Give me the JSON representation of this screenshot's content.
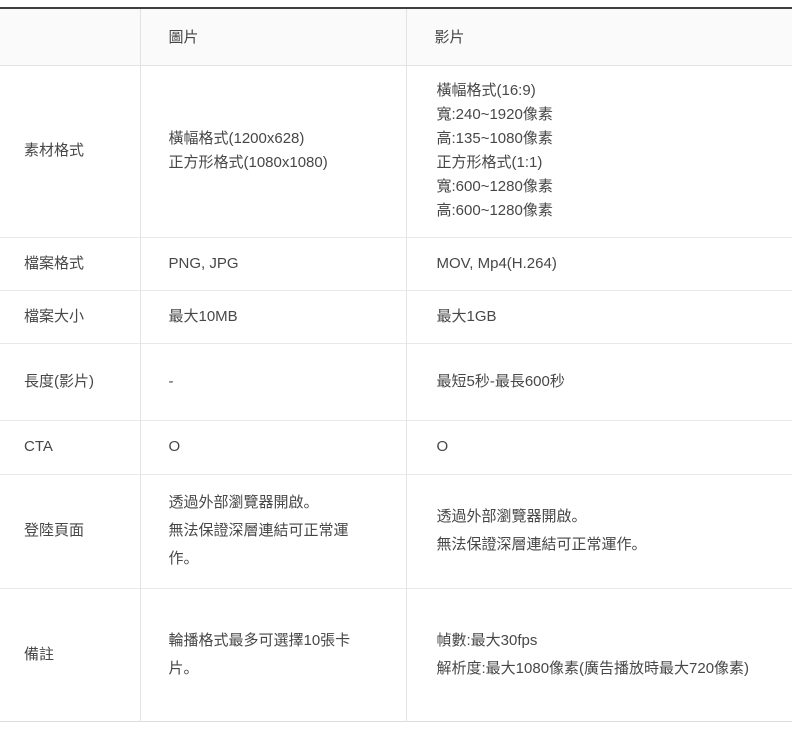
{
  "table": {
    "columns": [
      {
        "label": ""
      },
      {
        "label": "圖片"
      },
      {
        "label": "影片"
      }
    ],
    "rows": [
      {
        "label": "素材格式",
        "image": [
          "橫幅格式(1200x628)",
          "正方形格式(1080x1080)"
        ],
        "video": [
          "橫幅格式(16:9)",
          "寬:240~1920像素",
          "高:135~1080像素",
          "正方形格式(1:1)",
          "寬:600~1280像素",
          "高:600~1280像素"
        ],
        "variant": "tight"
      },
      {
        "label": "檔案格式",
        "image": [
          "PNG, JPG"
        ],
        "video": [
          "MOV, Mp4(H.264)"
        ],
        "variant": "tight"
      },
      {
        "label": "檔案大小",
        "image": [
          "最大10MB"
        ],
        "video": [
          "最大1GB"
        ],
        "variant": "tight"
      },
      {
        "label": "長度(影片)",
        "image": [
          "-"
        ],
        "video": [
          "最短5秒-最長600秒"
        ],
        "variant": "tight"
      },
      {
        "label": "CTA",
        "image": [
          "O"
        ],
        "video": [
          "O"
        ],
        "variant": "tight"
      },
      {
        "label": "登陸頁面",
        "image": [
          "透過外部瀏覽器開啟。",
          "無法保證深層連結可正常運作。"
        ],
        "video": [
          "透過外部瀏覽器開啟。",
          "無法保證深層連結可正常運作。"
        ],
        "variant": "loose",
        "narrow_image": true
      },
      {
        "label": "備註",
        "image": [
          "輪播格式最多可選擇10張卡片。"
        ],
        "video": [
          "幀數:最大30fps",
          "解析度:最大1080像素(廣告播放時最大720像素)"
        ],
        "variant": "loose"
      }
    ],
    "colors": {
      "top_rule": "#404040",
      "divider": "#e3e3e3",
      "header_bg": "#fafafa",
      "text": "#474747"
    }
  }
}
